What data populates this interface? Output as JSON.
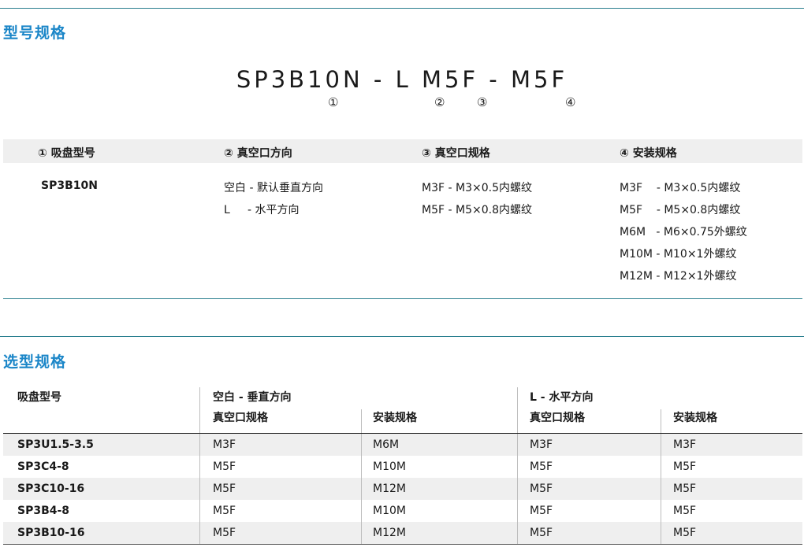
{
  "model_section": {
    "title": "型号规格",
    "model_code": "SP3B10N - L M5F - M5F",
    "markers": [
      "①",
      "②",
      "③",
      "④"
    ]
  },
  "spec_table": {
    "headers": [
      "① 吸盘型号",
      "② 真空口方向",
      "③ 真空口规格",
      "④ 安装规格"
    ],
    "col1": [
      "SP3B10N"
    ],
    "col2": [
      "空白 - 默认垂直方向",
      "L     - 水平方向"
    ],
    "col3": [
      "M3F - M3×0.5内螺纹",
      "M5F - M5×0.8内螺纹"
    ],
    "col4": [
      "M3F    - M3×0.5内螺纹",
      "M5F    - M5×0.8内螺纹",
      "M6M   - M6×0.75外螺纹",
      "M10M - M10×1外螺纹",
      "M12M - M12×1外螺纹"
    ]
  },
  "selection_section": {
    "title": "选型规格",
    "header_model": "吸盘型号",
    "group_a": "空白 - 垂直方向",
    "group_b": "L - 水平方向",
    "sub_vac": "真空口规格",
    "sub_mount": "安装规格",
    "rows": [
      [
        "SP3U1.5-3.5",
        "M3F",
        "M6M",
        "M3F",
        "M3F"
      ],
      [
        "SP3C4-8",
        "M5F",
        "M10M",
        "M5F",
        "M5F"
      ],
      [
        "SP3C10-16",
        "M5F",
        "M12M",
        "M5F",
        "M5F"
      ],
      [
        "SP3B4-8",
        "M5F",
        "M10M",
        "M5F",
        "M5F"
      ],
      [
        "SP3B10-16",
        "M5F",
        "M12M",
        "M5F",
        "M5F"
      ]
    ]
  }
}
